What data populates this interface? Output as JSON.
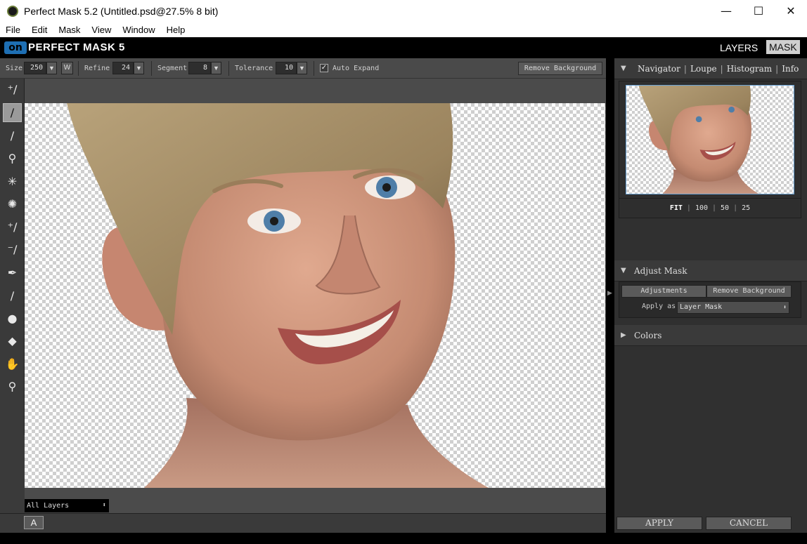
{
  "window": {
    "title": "Perfect Mask 5.2 (Untitled.psd@27.5% 8 bit)",
    "controls": [
      "—",
      "☐",
      "✕"
    ]
  },
  "menu": [
    "File",
    "Edit",
    "Mask",
    "View",
    "Window",
    "Help"
  ],
  "brand": {
    "logo": "on",
    "name": "PERFECT MASK 5",
    "modes": {
      "layers": "LAYERS",
      "mask": "MASK"
    }
  },
  "options": {
    "size_label": "Size",
    "size_value": "250",
    "w_label": "W",
    "refine_label": "Refine",
    "refine_value": "24",
    "segment_label": "Segment",
    "segment_value": "8",
    "tolerance_label": "Tolerance",
    "tolerance_value": "10",
    "auto_expand_label": "Auto Expand",
    "auto_expand_checked": "✓",
    "remove_bg_label": "Remove Background"
  },
  "navigator": {
    "tabs": [
      "Navigator",
      "Loupe",
      "Histogram",
      "Info"
    ],
    "zoom": [
      "FIT",
      "100",
      "50",
      "25"
    ]
  },
  "adjust_mask": {
    "title": "Adjust Mask",
    "tabs": [
      "Adjustments",
      "Remove Background"
    ],
    "apply_as_label": "Apply as",
    "apply_as_value": "Layer Mask"
  },
  "colors": {
    "title": "Colors"
  },
  "layers": {
    "selected": "All Layers"
  },
  "status": {
    "a_button": "A"
  },
  "actions": {
    "apply": "APPLY",
    "cancel": "CANCEL"
  },
  "colors_ui": {
    "accent": "#1e6fb3",
    "preview_border": "#6aa3d5"
  }
}
